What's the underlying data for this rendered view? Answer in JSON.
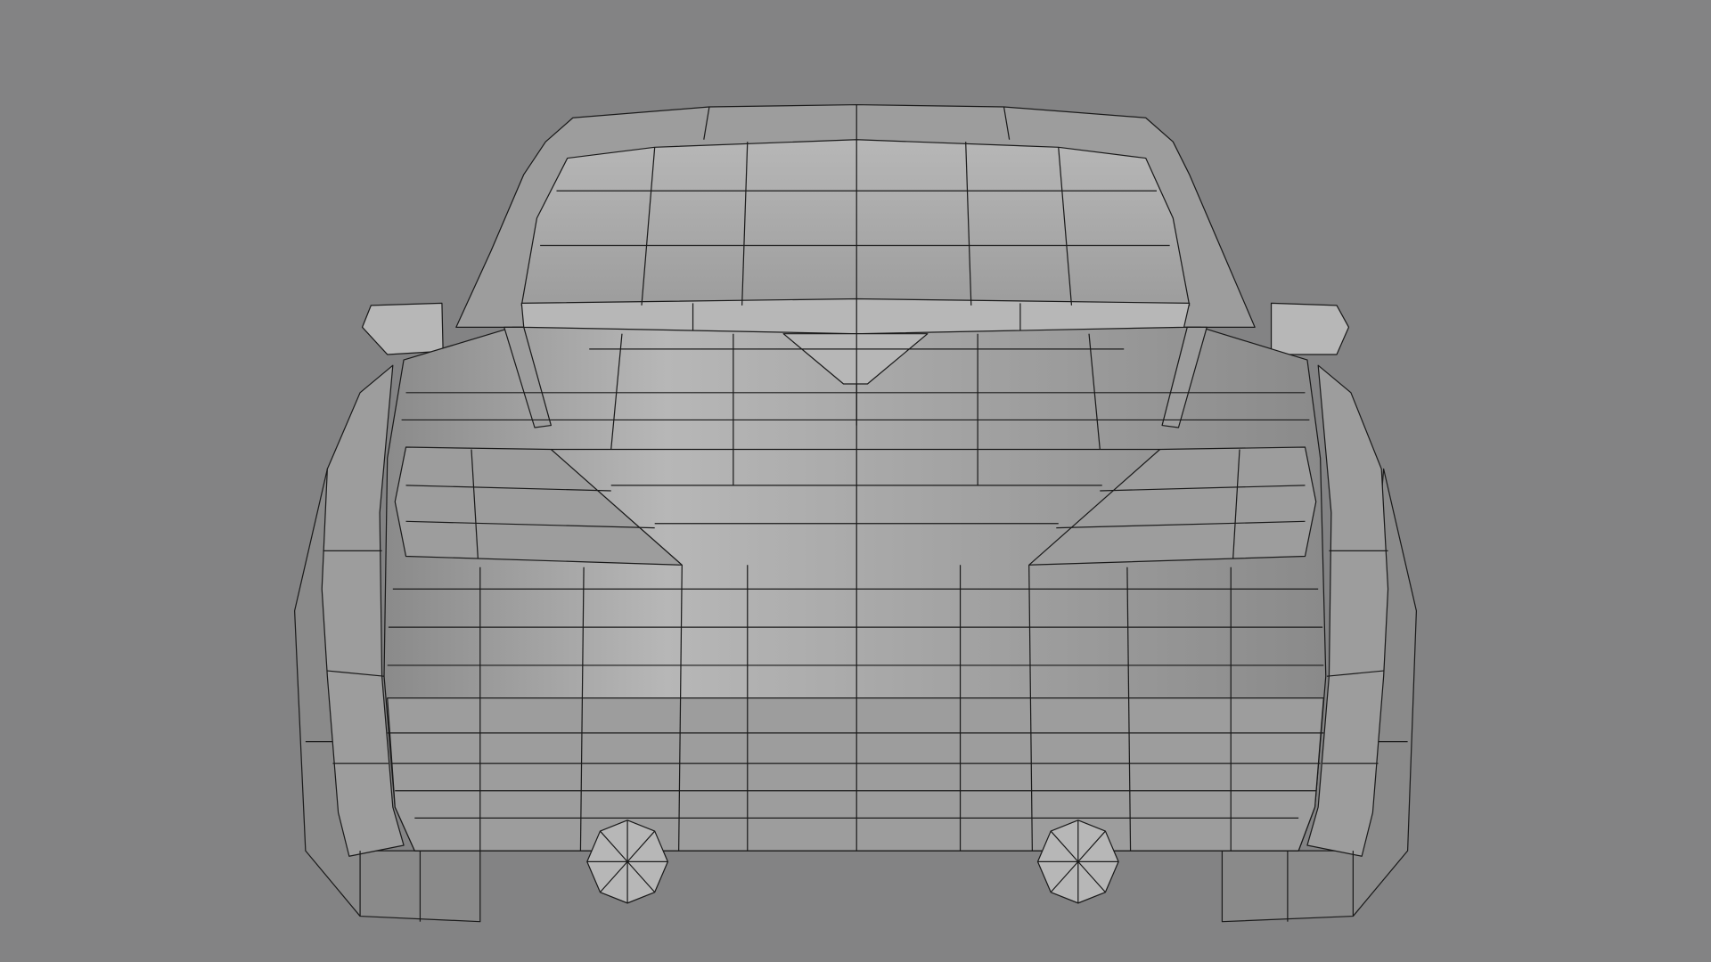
{
  "viewport": {
    "background_color": "#838384",
    "model_surface_color": "#9d9d9d",
    "model_light_color": "#b7b7b7",
    "model_shadow_color": "#8a8a8a",
    "wire_color": "#1a1a1a"
  },
  "model": {
    "subject": "car-rear-view",
    "display_mode": "wireframe-on-shaded"
  }
}
